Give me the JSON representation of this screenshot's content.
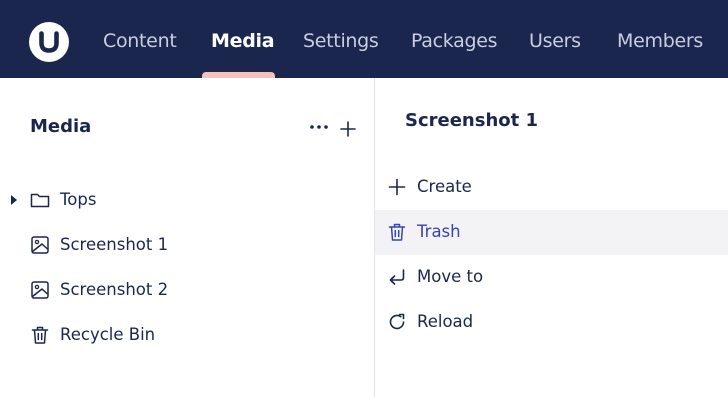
{
  "header": {
    "logo_icon": "umbraco-logo-icon",
    "nav": [
      {
        "label": "Content",
        "active": false
      },
      {
        "label": "Media",
        "active": true
      },
      {
        "label": "Settings",
        "active": false
      },
      {
        "label": "Packages",
        "active": false
      },
      {
        "label": "Users",
        "active": false
      },
      {
        "label": "Members",
        "active": false
      }
    ]
  },
  "tree": {
    "title": "Media",
    "more_icon": "ellipsis-icon",
    "add_icon": "plus-icon",
    "items": [
      {
        "label": "Tops",
        "icon": "folder-icon",
        "has_children": true
      },
      {
        "label": "Screenshot 1",
        "icon": "image-icon",
        "has_children": false
      },
      {
        "label": "Screenshot 2",
        "icon": "image-icon",
        "has_children": false
      },
      {
        "label": "Recycle Bin",
        "icon": "trash-icon",
        "has_children": false
      }
    ]
  },
  "actions": {
    "title": "Screenshot 1",
    "items": [
      {
        "label": "Create",
        "icon": "plus-icon"
      },
      {
        "label": "Trash",
        "icon": "trash-icon",
        "highlighted": true
      },
      {
        "label": "Move to",
        "icon": "move-arrow-icon"
      },
      {
        "label": "Reload",
        "icon": "reload-icon"
      }
    ]
  },
  "colors": {
    "header_bg": "#1b264f",
    "active_indicator": "#f5c1bc",
    "highlight_text": "#3544b1",
    "highlight_bg": "#f3f3f5"
  }
}
